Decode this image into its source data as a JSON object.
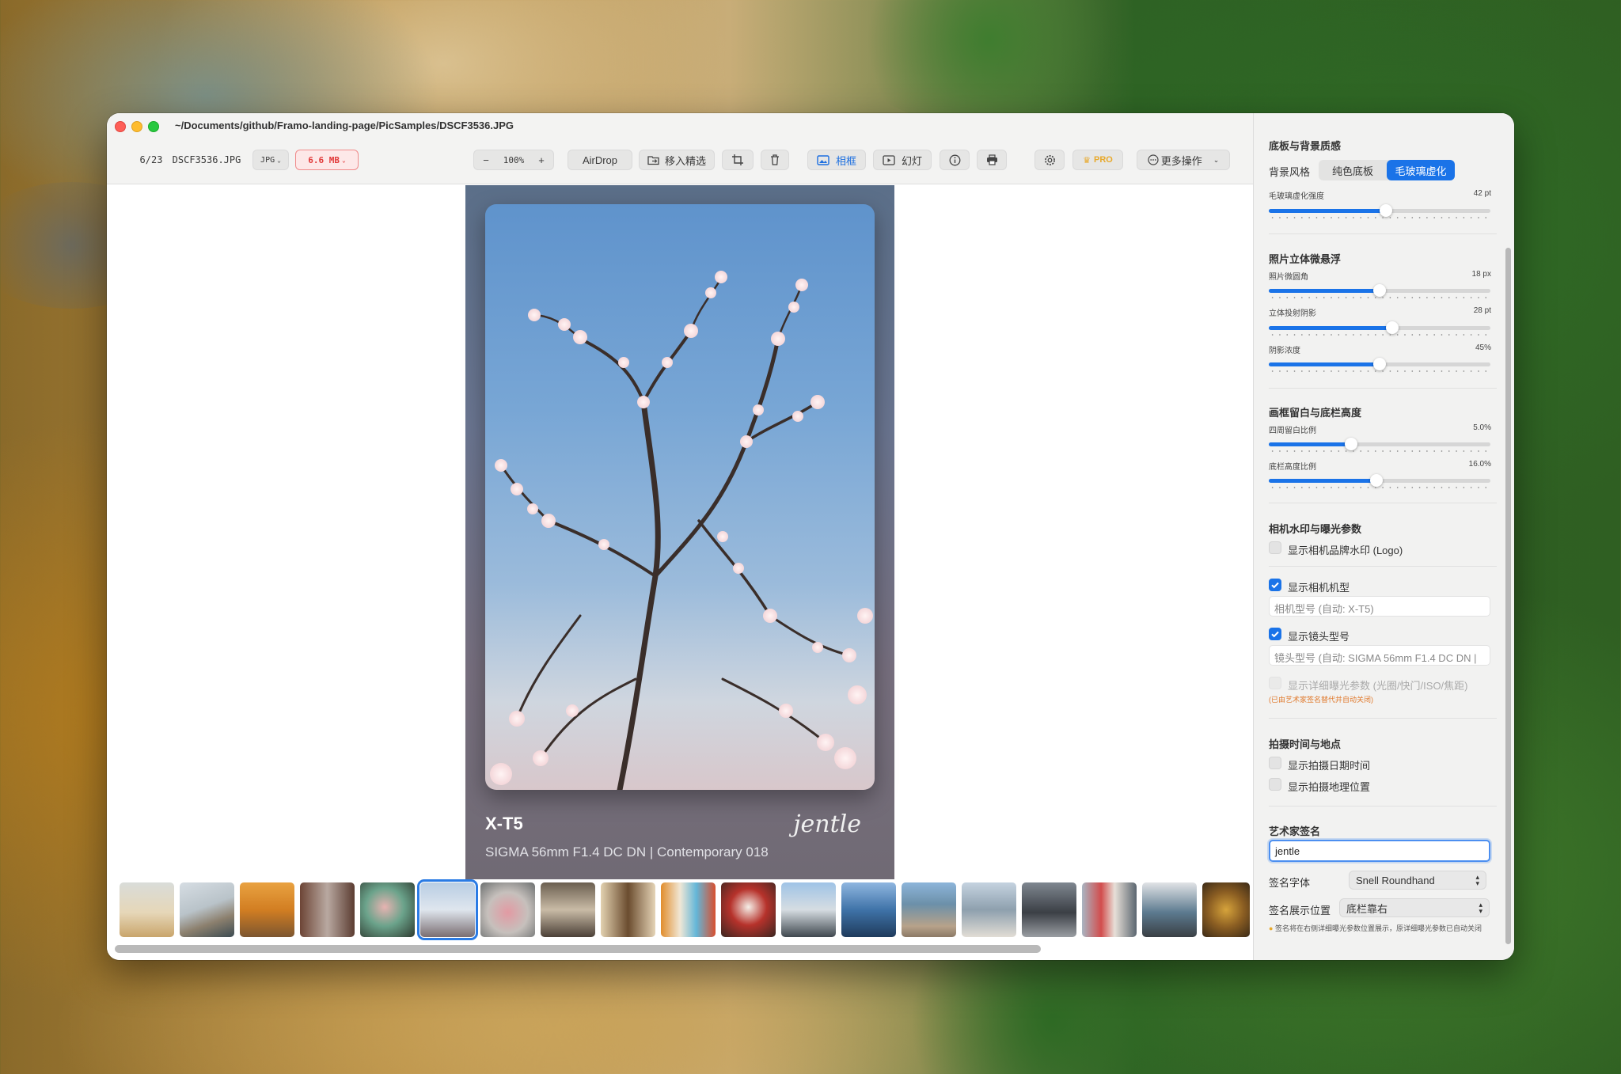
{
  "window": {
    "path_title": "~/Documents/github/Framo-landing-page/PicSamples/DSCF3536.JPG"
  },
  "toolbar": {
    "counter": "6/23",
    "filename": "DSCF3536.JPG",
    "format": "JPG",
    "size": "6.6 MB",
    "zoom_minus": "−",
    "zoom": "100%",
    "zoom_plus": "+",
    "airdrop": "AirDrop",
    "move_to_picks": "移入精选",
    "frame": "相框",
    "slideshow": "幻灯",
    "pro": "PRO",
    "more_actions": "更多操作"
  },
  "frame_preview": {
    "camera": "X-T5",
    "lens": "SIGMA 56mm F1.4 DC DN | Contemporary 018",
    "signature": "jentle"
  },
  "filmstrip": {
    "count": 19,
    "selected_index": 5
  },
  "panel": {
    "bg_section": {
      "title": "底板与背景质感",
      "style_label": "背景风格",
      "options": [
        "纯色底板",
        "毛玻璃虚化"
      ],
      "selected": "毛玻璃虚化",
      "blur_label": "毛玻璃虚化强度",
      "blur_value": "42 pt",
      "blur_level": 0.53
    },
    "float_section": {
      "title": "照片立体微悬浮",
      "sliders": [
        {
          "label": "照片微圆角",
          "value": "18 px",
          "level": 0.5
        },
        {
          "label": "立体投射阴影",
          "value": "28 pt",
          "level": 0.56
        },
        {
          "label": "阴影浓度",
          "value": "45%",
          "level": 0.5
        }
      ]
    },
    "margin_section": {
      "title": "画框留白与底栏高度",
      "sliders": [
        {
          "label": "四周留白比例",
          "value": "5.0%",
          "level": 0.37
        },
        {
          "label": "底栏高度比例",
          "value": "16.0%",
          "level": 0.48
        }
      ]
    },
    "watermark_section": {
      "title": "相机水印与曝光参数",
      "show_logo": "显示相机品牌水印 (Logo)",
      "show_model": "显示相机机型",
      "model_placeholder": "相机型号 (自动: X-T5)",
      "show_lens": "显示镜头型号",
      "lens_placeholder": "镜头型号 (自动: SIGMA 56mm F1.4 DC DN |",
      "show_exposure": "显示详细曝光参数 (光圈/快门/ISO/焦距)",
      "exposure_note": "(已由艺术家签名替代并自动关闭)"
    },
    "time_section": {
      "title": "拍摄时间与地点",
      "show_date": "显示拍摄日期时间",
      "show_location": "显示拍摄地理位置"
    },
    "signature_section": {
      "title": "艺术家签名",
      "signature_value": "jentle",
      "font_label": "签名字体",
      "font_value": "Snell Roundhand",
      "position_label": "签名展示位置",
      "position_value": "底栏靠右",
      "tip": "签名将在右侧详细曝光参数位置展示，原详细曝光参数已自动关闭"
    }
  },
  "colors": {
    "accent": "#1a73e8",
    "size_badge": "#e23a3a",
    "warning": "#e0782a",
    "pro": "#e8a92b"
  }
}
